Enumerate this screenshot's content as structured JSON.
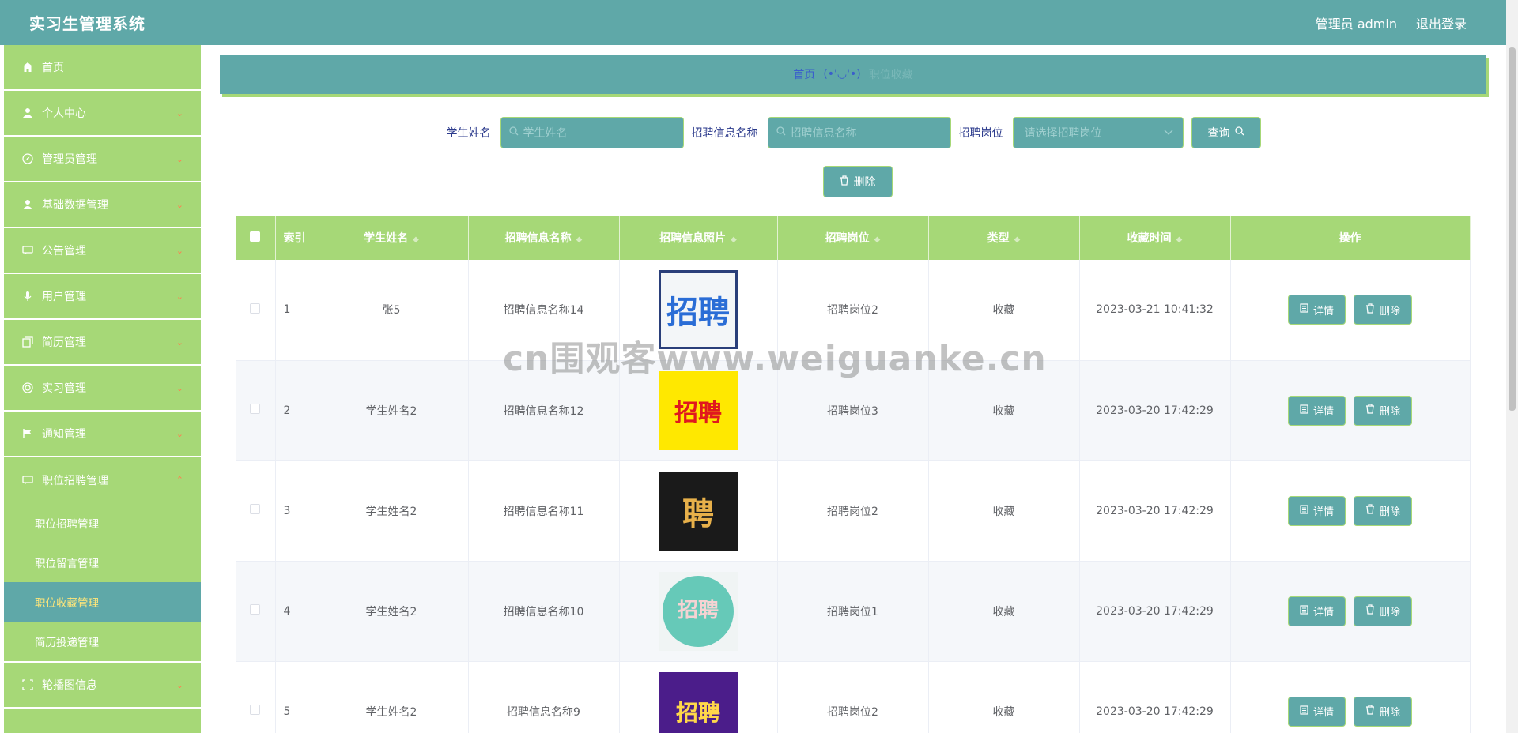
{
  "header": {
    "title": "实习生管理系统",
    "admin_label": "管理员 admin",
    "logout_label": "退出登录"
  },
  "sidebar": {
    "items": [
      {
        "label": "首页",
        "icon": "home-icon"
      },
      {
        "label": "个人中心",
        "icon": "user-icon"
      },
      {
        "label": "管理员管理",
        "icon": "compass-icon"
      },
      {
        "label": "基础数据管理",
        "icon": "user-icon"
      },
      {
        "label": "公告管理",
        "icon": "chat-icon"
      },
      {
        "label": "用户管理",
        "icon": "mic-icon"
      },
      {
        "label": "简历管理",
        "icon": "copy-icon"
      },
      {
        "label": "实习管理",
        "icon": "target-icon"
      },
      {
        "label": "通知管理",
        "icon": "flag-icon"
      },
      {
        "label": "职位招聘管理",
        "icon": "message-icon"
      },
      {
        "label": "轮播图信息",
        "icon": "fullscreen-icon"
      }
    ],
    "submenu": [
      "职位招聘管理",
      "职位留言管理",
      "职位收藏管理",
      "简历投递管理"
    ]
  },
  "breadcrumb": {
    "home": "首页",
    "face": "(•'◡'•)",
    "current": "职位收藏"
  },
  "search": {
    "student_label": "学生姓名",
    "student_placeholder": "学生姓名",
    "recruit_label": "招聘信息名称",
    "recruit_placeholder": "招聘信息名称",
    "position_label": "招聘岗位",
    "position_placeholder": "请选择招聘岗位",
    "query_label": "查询"
  },
  "toolbar": {
    "delete_label": "删除"
  },
  "table": {
    "headers": [
      "索引",
      "学生姓名",
      "招聘信息名称",
      "招聘信息照片",
      "招聘岗位",
      "类型",
      "收藏时间",
      "操作"
    ],
    "rows": [
      {
        "index": "1",
        "student": "张5",
        "recruit": "招聘信息名称14",
        "photo_text": "招聘",
        "position": "招聘岗位2",
        "type": "收藏",
        "time": "2023-03-21 10:41:32"
      },
      {
        "index": "2",
        "student": "学生姓名2",
        "recruit": "招聘信息名称12",
        "photo_text": "招聘",
        "position": "招聘岗位3",
        "type": "收藏",
        "time": "2023-03-20 17:42:29"
      },
      {
        "index": "3",
        "student": "学生姓名2",
        "recruit": "招聘信息名称11",
        "photo_text": "聘",
        "position": "招聘岗位2",
        "type": "收藏",
        "time": "2023-03-20 17:42:29"
      },
      {
        "index": "4",
        "student": "学生姓名2",
        "recruit": "招聘信息名称10",
        "photo_text": "招聘",
        "position": "招聘岗位1",
        "type": "收藏",
        "time": "2023-03-20 17:42:29"
      },
      {
        "index": "5",
        "student": "学生姓名2",
        "recruit": "招聘信息名称9",
        "photo_text": "招聘",
        "position": "招聘岗位2",
        "type": "收藏",
        "time": "2023-03-20 17:42:29"
      }
    ],
    "detail_label": "详情",
    "delete_label": "删除"
  },
  "watermark": "cn围观客www.weiguanke.cn",
  "colors": {
    "header": "#5fa8a8",
    "sidebar": "#a6d877",
    "accent": "#5fa8a8",
    "active_text": "#ffe67a"
  }
}
